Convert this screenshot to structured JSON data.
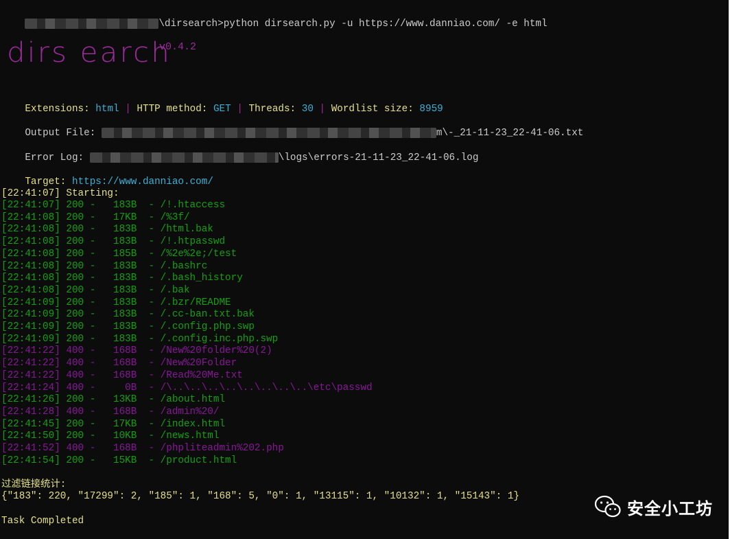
{
  "command": {
    "path_suffix": "\\dirsearch>",
    "text": "python dirsearch.py -u https://www.danniao.com/ -e html"
  },
  "logo": {
    "text": "dirs earch",
    "version": "v0.4.2"
  },
  "config": {
    "extensions_label": "Extensions:",
    "extensions_value": "html",
    "method_label": "HTTP method:",
    "method_value": "GET",
    "threads_label": "Threads:",
    "threads_value": "30",
    "wordlist_label": "Wordlist size:",
    "wordlist_value": "8959",
    "separator": "|"
  },
  "output_file": {
    "label": "Output File:",
    "suffix": "m\\-_21-11-23_22-41-06.txt"
  },
  "error_log": {
    "label": "Error Log:",
    "suffix": "\\logs\\errors-21-11-23_22-41-06.log"
  },
  "target": {
    "label": "Target:",
    "value": "https://www.danniao.com/"
  },
  "starting": "[22:41:07] Starting:",
  "results": [
    {
      "time": "[22:41:07]",
      "status": "200",
      "size": "183B",
      "path": "/!.htaccess"
    },
    {
      "time": "[22:41:08]",
      "status": "200",
      "size": "17KB",
      "path": "/%3f/"
    },
    {
      "time": "[22:41:08]",
      "status": "200",
      "size": "183B",
      "path": "/html.bak"
    },
    {
      "time": "[22:41:08]",
      "status": "200",
      "size": "183B",
      "path": "/!.htpasswd"
    },
    {
      "time": "[22:41:08]",
      "status": "200",
      "size": "185B",
      "path": "/%2e%2e;/test"
    },
    {
      "time": "[22:41:08]",
      "status": "200",
      "size": "183B",
      "path": "/.bashrc"
    },
    {
      "time": "[22:41:08]",
      "status": "200",
      "size": "183B",
      "path": "/.bash_history"
    },
    {
      "time": "[22:41:08]",
      "status": "200",
      "size": "183B",
      "path": "/.bak"
    },
    {
      "time": "[22:41:09]",
      "status": "200",
      "size": "183B",
      "path": "/.bzr/README"
    },
    {
      "time": "[22:41:09]",
      "status": "200",
      "size": "183B",
      "path": "/.cc-ban.txt.bak"
    },
    {
      "time": "[22:41:09]",
      "status": "200",
      "size": "183B",
      "path": "/.config.php.swp"
    },
    {
      "time": "[22:41:09]",
      "status": "200",
      "size": "183B",
      "path": "/.config.inc.php.swp"
    },
    {
      "time": "[22:41:22]",
      "status": "400",
      "size": "168B",
      "path": "/New%20folder%20(2)"
    },
    {
      "time": "[22:41:22]",
      "status": "400",
      "size": "168B",
      "path": "/New%20Folder"
    },
    {
      "time": "[22:41:22]",
      "status": "400",
      "size": "168B",
      "path": "/Read%20Me.txt"
    },
    {
      "time": "[22:41:24]",
      "status": "400",
      "size": "0B",
      "path": "/\\..\\..\\..\\..\\..\\..\\..\\..\\etc\\passwd"
    },
    {
      "time": "[22:41:26]",
      "status": "200",
      "size": "13KB",
      "path": "/about.html"
    },
    {
      "time": "[22:41:28]",
      "status": "400",
      "size": "168B",
      "path": "/admin%20/"
    },
    {
      "time": "[22:41:45]",
      "status": "200",
      "size": "17KB",
      "path": "/index.html"
    },
    {
      "time": "[22:41:50]",
      "status": "200",
      "size": "10KB",
      "path": "/news.html"
    },
    {
      "time": "[22:41:52]",
      "status": "400",
      "size": "168B",
      "path": "/phpliteadmin%202.php"
    },
    {
      "time": "[22:41:54]",
      "status": "200",
      "size": "15KB",
      "path": "/product.html"
    }
  ],
  "filter_title": "过滤链接统计:",
  "filter_stats": "{\"183\": 220, \"17299\": 2, \"185\": 1, \"168\": 5, \"0\": 1, \"13115\": 1, \"10132\": 1, \"15143\": 1}",
  "task_completed": "Task Completed",
  "watermark": {
    "text": "安全小工坊",
    "icon": "wechat-icon"
  },
  "colors": {
    "background": "#0c0c0c",
    "green": "#13a10e",
    "magenta": "#881798",
    "cyan": "#3db0d6",
    "yellow": "#e5e08a",
    "grey": "#cccccc"
  }
}
